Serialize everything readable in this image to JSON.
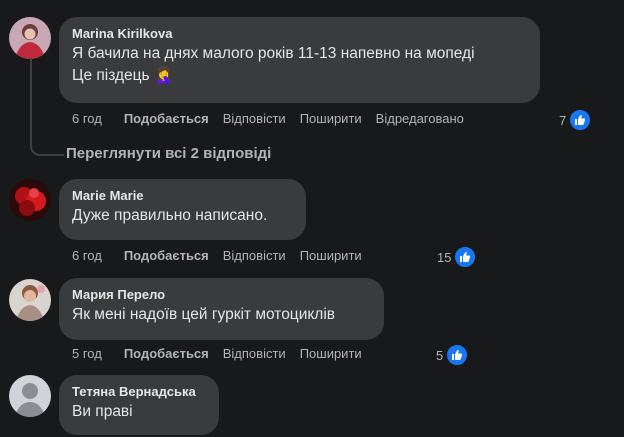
{
  "comments": [
    {
      "author": "Marina Kirilkova",
      "lines": [
        "Я бачила на днях малого років 11-13 напевно на мопеді",
        "Це піздець"
      ],
      "emoji": "🤦‍♀️",
      "time": "6 год",
      "like": "Подобається",
      "reply": "Відповісти",
      "share": "Поширити",
      "edited": "Відредаговано",
      "reactions": "7"
    },
    {
      "author": "Marie Marie",
      "lines": [
        "Дуже правильно написано."
      ],
      "time": "6 год",
      "like": "Подобається",
      "reply": "Відповісти",
      "share": "Поширити",
      "reactions": "15"
    },
    {
      "author": "Мария Перело",
      "lines": [
        "Як мені надоїв цей гуркіт мотоциклів"
      ],
      "time": "5 год",
      "like": "Подобається",
      "reply": "Відповісти",
      "share": "Поширити",
      "reactions": "5"
    },
    {
      "author": "Тетяна Вернадська",
      "lines": [
        "Ви праві"
      ]
    }
  ],
  "view_replies": "Переглянути всі 2 відповіді",
  "icons": {
    "reaction": "like-thumb-icon",
    "default_avatar": "default-avatar-icon"
  },
  "colors": {
    "like_blue": "#1877f2",
    "bubble": "#3a3b3c",
    "background": "#18191a"
  }
}
